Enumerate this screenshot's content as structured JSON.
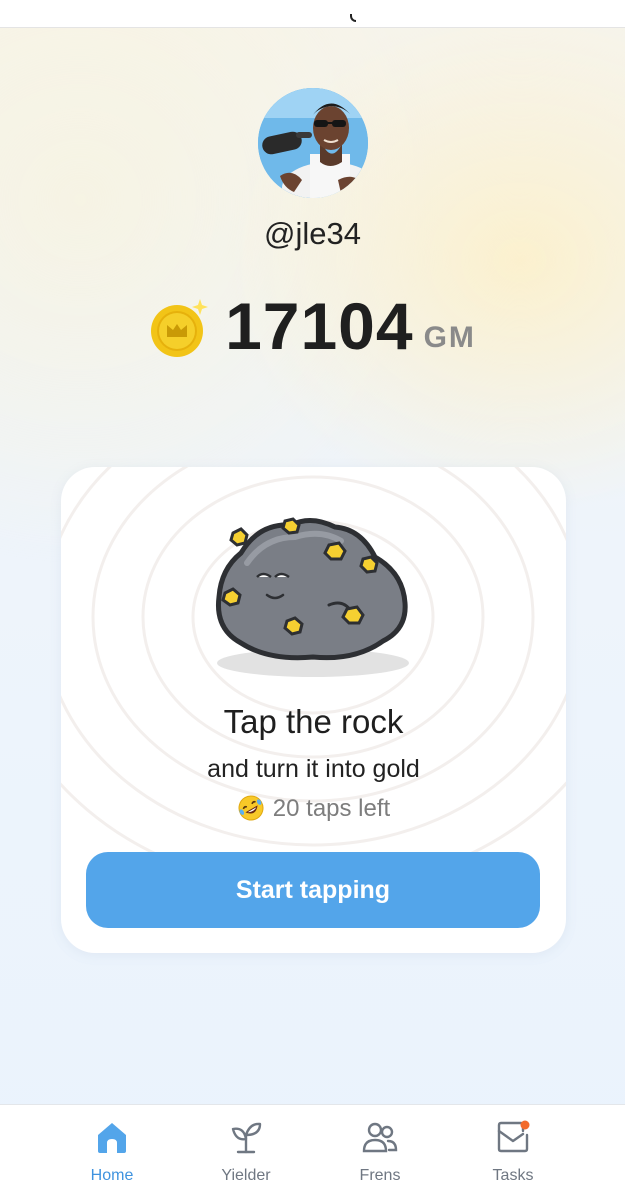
{
  "profile": {
    "username": "@jle34",
    "avatar_icon": "user-avatar-photo"
  },
  "balance": {
    "amount": "17104",
    "unit": "GM",
    "coin_icon": "gold-coin-icon"
  },
  "card": {
    "title": "Tap the rock",
    "subtitle": "and turn it into gold",
    "taps_emoji": "rofl-emoji-icon",
    "taps_text": "20 taps left",
    "button_label": "Start tapping"
  },
  "nav": {
    "items": [
      {
        "label": "Home",
        "icon": "home-icon",
        "active": true
      },
      {
        "label": "Yielder",
        "icon": "sprout-icon",
        "active": false
      },
      {
        "label": "Frens",
        "icon": "friends-icon",
        "active": false
      },
      {
        "label": "Tasks",
        "icon": "tasks-mail-icon",
        "active": false
      }
    ]
  },
  "colors": {
    "accent": "#53a5ea",
    "nav_active": "#3f93df",
    "coin": "#f2c417",
    "notification_dot": "#f26b2c"
  }
}
